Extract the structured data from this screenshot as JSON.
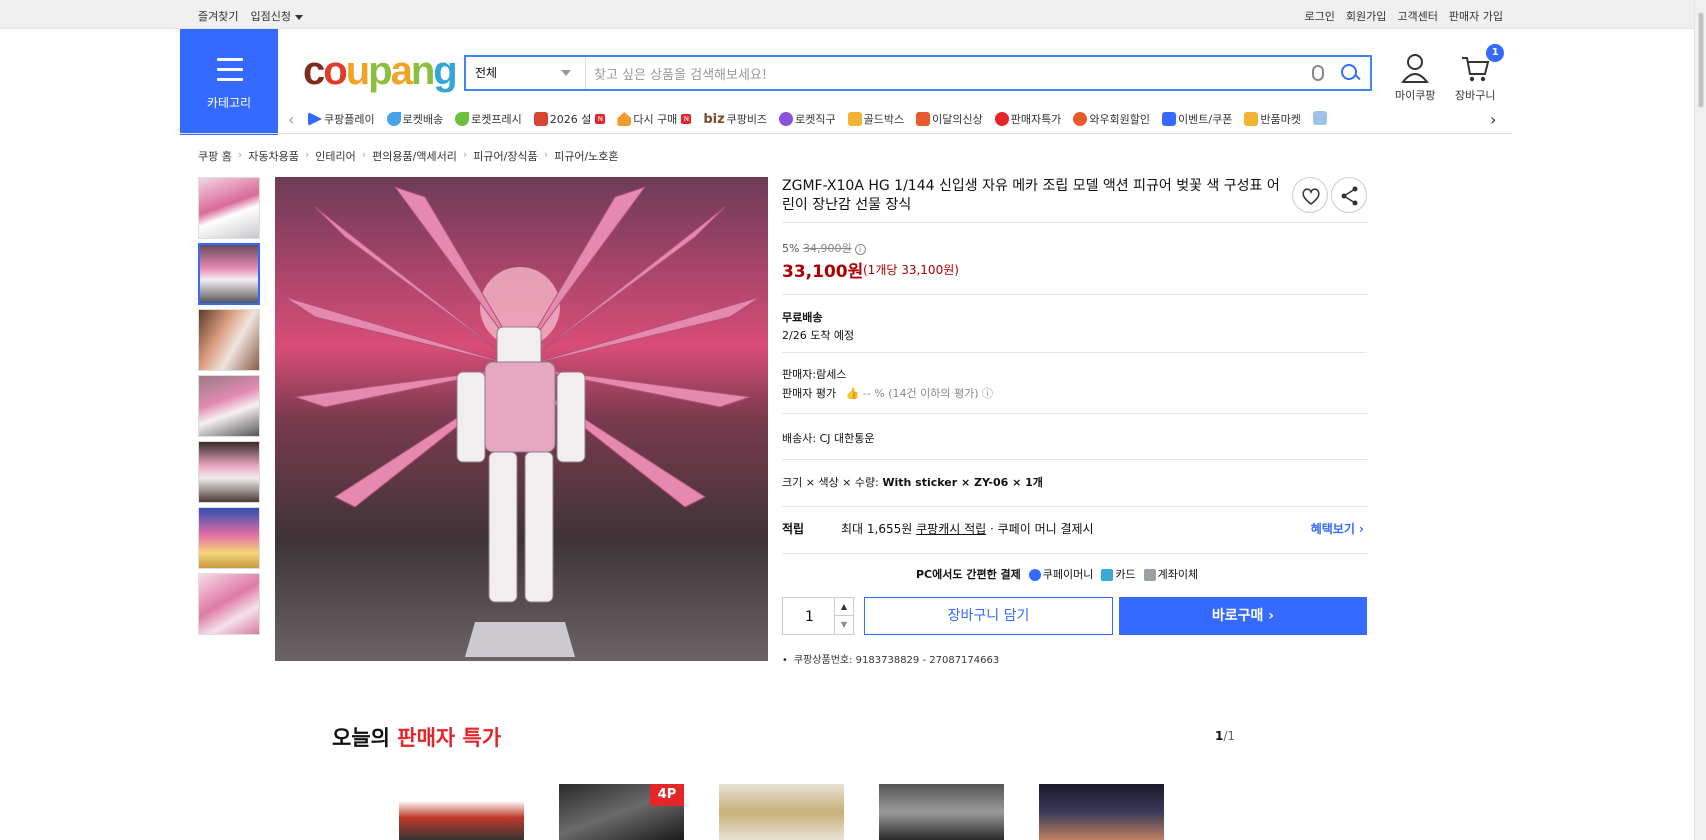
{
  "topbar": {
    "left": [
      "즐겨찾기",
      "입점신청"
    ],
    "right": [
      "로그인",
      "회원가입",
      "고객센터",
      "판매자 가입"
    ]
  },
  "header": {
    "category_label": "카테고리",
    "logo": "coupang",
    "search_category": "전체",
    "search_placeholder": "찾고 싶은 상품을 검색해보세요!",
    "mycoupang_label": "마이쿠팡",
    "cart_label": "장바구니",
    "cart_count": "1"
  },
  "nav": [
    {
      "label": "쿠팡플레이",
      "color": "#346aff"
    },
    {
      "label": "로켓배송",
      "color": "#4aa3e8"
    },
    {
      "label": "로켓프레시",
      "color": "#6bbf3a"
    },
    {
      "label": "2026 설",
      "color": "#d6452f"
    },
    {
      "label": "다시 구매",
      "color": "#f29a2e"
    },
    {
      "label": "쿠팡비즈",
      "color": "#7a4b2b"
    },
    {
      "label": "로켓직구",
      "color": "#8b53d6"
    },
    {
      "label": "골드박스",
      "color": "#f2b233"
    },
    {
      "label": "이달의신상",
      "color": "#e85a2d"
    },
    {
      "label": "판매자특가",
      "color": "#e52528"
    },
    {
      "label": "와우회원할인",
      "color": "#e85a2d"
    },
    {
      "label": "이벤트/쿠폰",
      "color": "#346aff"
    },
    {
      "label": "반품마켓",
      "color": "#f2b233"
    }
  ],
  "nav_extra": {
    "biz_prefix": "biz",
    "badge": "N"
  },
  "breadcrumb": [
    "쿠팡 홈",
    "자동차용품",
    "인테리어",
    "편의용품/액세서리",
    "피규어/장식품",
    "피규어/노호혼"
  ],
  "product": {
    "title": "ZGMF-X10A HG 1/144 신입생 자유 메카 조립 모델 액션 피규어 벚꽃 색 구성표 어린이 장난감 선물 장식",
    "discount_rate": "5%",
    "original_price": "34,900원",
    "price": "33,100원",
    "unit_price": "(1개당 33,100원)",
    "shipping_title": "무료배송",
    "arrival": "2/26 도착 예정",
    "seller_label": "판매자:",
    "seller": "람세스",
    "seller_rating_label": "판매자 평가",
    "seller_rating_text": "-- % (14건 이하의 평가)",
    "courier_label": "배송사:",
    "courier": "CJ 대한통운",
    "option_label": "크기 × 색상 × 수량:",
    "option_value": "With sticker × ZY-06 × 1개",
    "accrue_label": "적립",
    "accrue_prefix": "최대 1,655원",
    "accrue_link": "쿠팡캐시 적립",
    "accrue_suffix": "· 쿠페이 머니 결제시",
    "benefit_link": "혜택보기 ›",
    "pay_title": "PC에서도 간편한 결제",
    "pay_methods": [
      "쿠페이머니",
      "카드",
      "계좌이체"
    ],
    "quantity": "1",
    "cart_button": "장바구니 담기",
    "buy_button": "바로구매 ›",
    "product_number": "쿠팡상품번호: 9183738829 - 27087174663"
  },
  "deals": {
    "title_prefix": "오늘의",
    "title_highlight": "판매자 특가",
    "page_current": "1",
    "page_total": "/1",
    "badge": "4P"
  }
}
